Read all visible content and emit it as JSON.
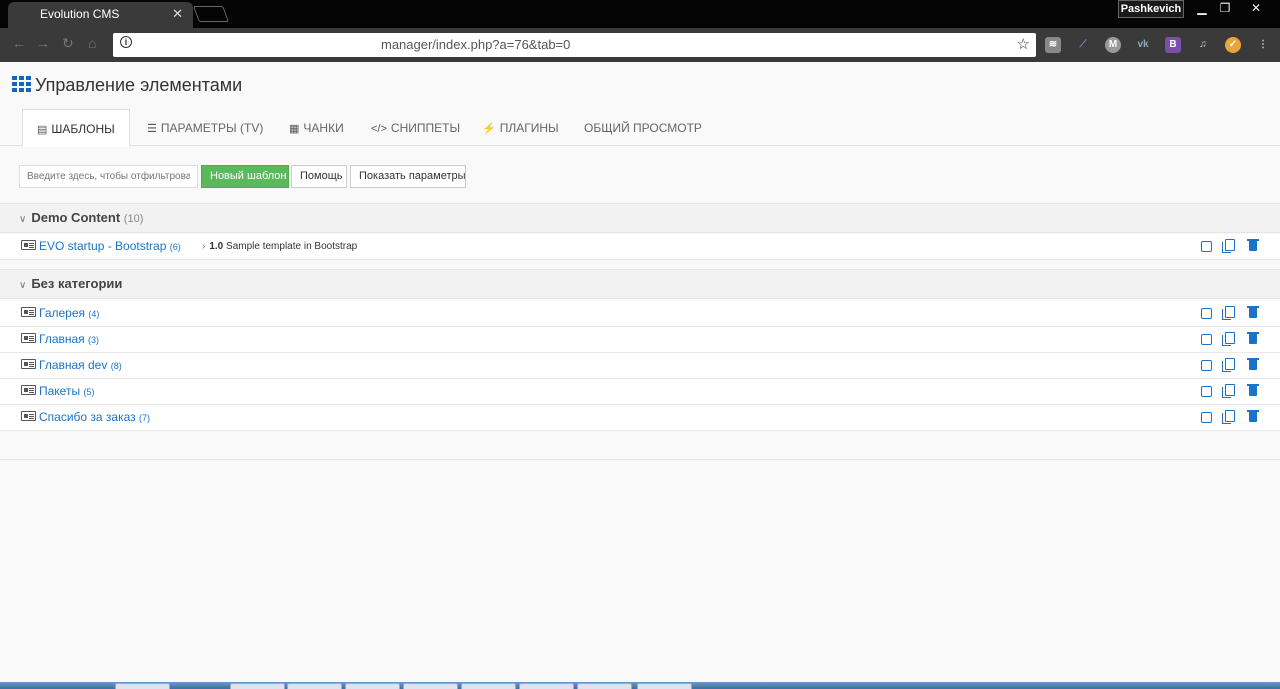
{
  "browser": {
    "tab_title": "Evolution CMS",
    "tab_close": "✕",
    "profile_name": "Pashkevich",
    "url": "manager/index.php?a=76&tab=0"
  },
  "page": {
    "title": "Управление элементами"
  },
  "tabs": [
    {
      "label": "ШАБЛОНЫ",
      "icon": "template-icon",
      "active": true
    },
    {
      "label": "ПАРАМЕТРЫ (TV)",
      "icon": "list-icon",
      "active": false
    },
    {
      "label": "ЧАНКИ",
      "icon": "grid-icon",
      "active": false
    },
    {
      "label": "СНИППЕТЫ",
      "icon": "code-icon",
      "active": false
    },
    {
      "label": "ПЛАГИНЫ",
      "icon": "plug-icon",
      "active": false
    },
    {
      "label": "ОБЩИЙ ПРОСМОТР",
      "icon": "",
      "active": false
    }
  ],
  "toolbar": {
    "filter_placeholder": "Введите здесь, чтобы отфильтровать",
    "new_template": "Новый шаблон",
    "help": "Помощь",
    "show_params": "Показать параметры"
  },
  "categories": [
    {
      "name": "Demo Content",
      "count": "(10)",
      "items": [
        {
          "name": "EVO startup - Bootstrap",
          "id": "(6)",
          "version": "1.0",
          "description": "Sample template in Bootstrap"
        }
      ]
    },
    {
      "name": "Без категории",
      "count": "",
      "items": [
        {
          "name": "Галерея",
          "id": "(4)"
        },
        {
          "name": "Главная",
          "id": "(3)"
        },
        {
          "name": "Главная dev",
          "id": "(8)"
        },
        {
          "name": "Пакеты",
          "id": "(5)"
        },
        {
          "name": "Спасибо за заказ",
          "id": "(7)"
        }
      ]
    }
  ],
  "colors": {
    "link": "#1a73c8",
    "accent_green": "#5cb85c",
    "grid_icon": "#1565c0"
  }
}
